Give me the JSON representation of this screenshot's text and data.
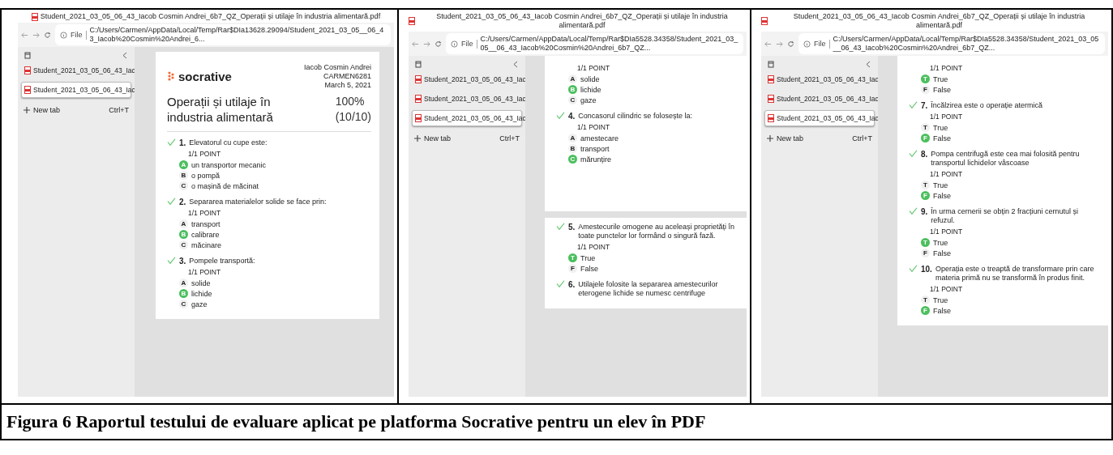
{
  "panels": [
    {
      "title": "Student_2021_03_05_06_43_Iacob Cosmin Andrei_6b7_QZ_Operații și utilaje în industria alimentară.pdf",
      "address": {
        "scheme": "File",
        "url": "C:/Users/Carmen/AppData/Local/Temp/Rar$DIa13628.29094/Student_2021_03_05__06_43_Iacob%20Cosmin%20Andrei_6..."
      },
      "tabs": [
        {
          "label": "Student_2021_03_05_06_43_Iac",
          "selected": false
        },
        {
          "label": "Student_2021_03_05_06_43_Iac",
          "selected": true
        }
      ],
      "new_tab": {
        "label": "New tab",
        "shortcut": "Ctrl+T"
      },
      "pages": [
        {
          "items": [
            {
              "kind": "header",
              "logo": "socrative",
              "student": [
                "Iacob Cosmin Andrei",
                "CARMEN6281",
                "March 5, 2021"
              ],
              "title": "Operații și utilaje în industria alimentară",
              "score": "100%",
              "fraction": "(10/10)"
            },
            {
              "kind": "question",
              "number": "1.",
              "text": "Elevatorul cu cupe este:",
              "points": "1/1 POINT",
              "options": [
                {
                  "letter": "A",
                  "text": "un transportor mecanic",
                  "selected": true
                },
                {
                  "letter": "B",
                  "text": "o pompă",
                  "selected": false
                },
                {
                  "letter": "C",
                  "text": "o mașină de măcinat",
                  "selected": false
                }
              ]
            },
            {
              "kind": "question",
              "number": "2.",
              "text": "Separarea materialelor solide se face prin:",
              "points": "1/1 POINT",
              "options": [
                {
                  "letter": "A",
                  "text": "transport",
                  "selected": false
                },
                {
                  "letter": "B",
                  "text": "calibrare",
                  "selected": true
                },
                {
                  "letter": "C",
                  "text": "măcinare",
                  "selected": false
                }
              ]
            },
            {
              "kind": "question",
              "number": "3.",
              "text": "Pompele transportă:",
              "points": "1/1 POINT",
              "options": [
                {
                  "letter": "A",
                  "text": "solide",
                  "selected": false
                },
                {
                  "letter": "B",
                  "text": "lichide",
                  "selected": true
                },
                {
                  "letter": "C",
                  "text": "gaze",
                  "selected": false
                }
              ]
            }
          ]
        }
      ]
    },
    {
      "title": "Student_2021_03_05_06_43_Iacob Cosmin Andrei_6b7_QZ_Operații și utilaje în industria alimentară.pdf",
      "address": {
        "scheme": "File",
        "url": "C:/Users/Carmen/AppData/Local/Temp/Rar$DIa5528.34358/Student_2021_03_05__06_43_Iacob%20Cosmin%20Andrei_6b7_QZ..."
      },
      "tabs": [
        {
          "label": "Student_2021_03_05_06_43_Iac",
          "selected": false
        },
        {
          "label": "Student_2021_03_05_06_43_Iac",
          "selected": false
        },
        {
          "label": "Student_2021_03_05_06_43_Iac",
          "selected": true
        }
      ],
      "new_tab": {
        "label": "New tab",
        "shortcut": "Ctrl+T"
      },
      "pages": [
        {
          "items": [
            {
              "kind": "options",
              "points": "1/1 POINT",
              "options": [
                {
                  "letter": "A",
                  "text": "solide",
                  "selected": false
                },
                {
                  "letter": "B",
                  "text": "lichide",
                  "selected": true
                },
                {
                  "letter": "C",
                  "text": "gaze",
                  "selected": false
                }
              ]
            },
            {
              "kind": "question",
              "number": "4.",
              "text": "Concasorul cilindric se folosește la:",
              "points": "1/1 POINT",
              "options": [
                {
                  "letter": "A",
                  "text": "amestecare",
                  "selected": false
                },
                {
                  "letter": "B",
                  "text": "transport",
                  "selected": false
                },
                {
                  "letter": "C",
                  "text": "mărunțire",
                  "selected": true
                }
              ]
            }
          ]
        },
        {
          "items": [
            {
              "kind": "question",
              "number": "5.",
              "text": "Amestecurile omogene au aceleași proprietăți în toate punctelor lor formând o singură fază.",
              "points": "1/1 POINT",
              "options": [
                {
                  "letter": "T",
                  "text": "True",
                  "selected": true
                },
                {
                  "letter": "F",
                  "text": "False",
                  "selected": false
                }
              ]
            },
            {
              "kind": "question",
              "number": "6.",
              "text": "Utilajele folosite la separarea amestecurilor eterogene lichide se numesc centrifuge"
            }
          ]
        }
      ]
    },
    {
      "title": "Student_2021_03_05_06_43_Iacob Cosmin Andrei_6b7_QZ_Operații și utilaje în industria alimentară.pdf",
      "address": {
        "scheme": "File",
        "url": "C:/Users/Carmen/AppData/Local/Temp/Rar$DIa5528.34358/Student_2021_03_05__06_43_Iacob%20Cosmin%20Andrei_6b7_QZ..."
      },
      "tabs": [
        {
          "label": "Student_2021_03_05_06_43_Iac",
          "selected": false
        },
        {
          "label": "Student_2021_03_05_06_43_Iac",
          "selected": false
        },
        {
          "label": "Student_2021_03_05_06_43_Iac",
          "selected": true
        }
      ],
      "new_tab": {
        "label": "New tab",
        "shortcut": "Ctrl+T"
      },
      "pages": [
        {
          "items": [
            {
              "kind": "options",
              "points": "1/1 POINT",
              "options": [
                {
                  "letter": "T",
                  "text": "True",
                  "selected": true
                },
                {
                  "letter": "F",
                  "text": "False",
                  "selected": false
                }
              ]
            },
            {
              "kind": "question",
              "number": "7.",
              "text": "Încălzirea este o operație atermică",
              "points": "1/1 POINT",
              "options": [
                {
                  "letter": "T",
                  "text": "True",
                  "selected": false
                },
                {
                  "letter": "F",
                  "text": "False",
                  "selected": true
                }
              ]
            },
            {
              "kind": "question",
              "number": "8.",
              "text": "Pompa centrifugă este cea mai folosită pentru transportul lichidelor vâscoase",
              "points": "1/1 POINT",
              "options": [
                {
                  "letter": "T",
                  "text": "True",
                  "selected": false
                },
                {
                  "letter": "F",
                  "text": "False",
                  "selected": true
                }
              ]
            },
            {
              "kind": "question",
              "number": "9.",
              "text": "În urma cernerii se obțin 2 fracțiuni cernutul și refuzul.",
              "points": "1/1 POINT",
              "options": [
                {
                  "letter": "T",
                  "text": "True",
                  "selected": true
                },
                {
                  "letter": "F",
                  "text": "False",
                  "selected": false
                }
              ]
            },
            {
              "kind": "question",
              "number": "10.",
              "text": "Operația este o treaptă de transformare prin care materia primă nu se transformă în produs finit.",
              "points": "1/1 POINT",
              "options": [
                {
                  "letter": "T",
                  "text": "True",
                  "selected": false
                },
                {
                  "letter": "F",
                  "text": "False",
                  "selected": true
                }
              ]
            }
          ]
        }
      ]
    }
  ],
  "caption": "Figura 6 Raportul testului de evaluare aplicat pe platforma Socrative pentru un elev în PDF"
}
